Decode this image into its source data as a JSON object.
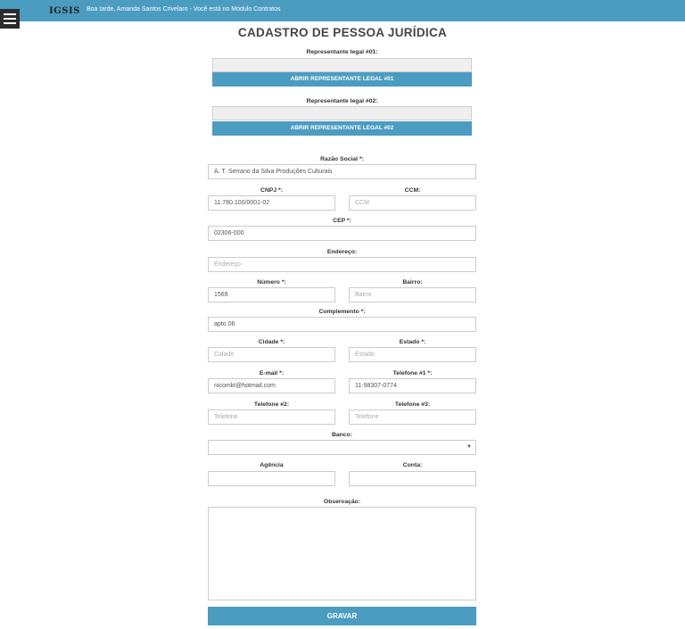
{
  "header": {
    "logo": "IGSIS",
    "greeting": "Boa tarde, Amanda Santos Crivelaro - Você está no Módulo Contratos"
  },
  "page": {
    "title": "CADASTRO DE PESSOA JURÍDICA"
  },
  "rep1": {
    "label": "Representante legal #01:",
    "button": "ABRIR REPRESENTANTE LEGAL #01"
  },
  "rep2": {
    "label": "Representante legal #02:",
    "button": "ABRIR REPRESENTANTE LEGAL #02"
  },
  "form": {
    "razao_social": {
      "label": "Razão Social *:",
      "value": "A. T. Serrano da Silva Produções Culturais"
    },
    "cnpj": {
      "label": "CNPJ *:",
      "value": "11.780.100/0001-02"
    },
    "ccm": {
      "label": "CCM:",
      "placeholder": "CCM"
    },
    "cep": {
      "label": "CEP *:",
      "value": "02306-000"
    },
    "endereco": {
      "label": "Endereço:",
      "placeholder": "Endereço"
    },
    "numero": {
      "label": "Número *:",
      "value": "1569"
    },
    "bairro": {
      "label": "Bairro:",
      "placeholder": "Bairro"
    },
    "complemento": {
      "label": "Complemento *:",
      "value": "apto 06"
    },
    "cidade": {
      "label": "Cidade *:",
      "placeholder": "Cidade"
    },
    "estado": {
      "label": "Estado *:",
      "placeholder": "Estado"
    },
    "email": {
      "label": "E-mail *:",
      "value": "nicomkt@hotmail.com"
    },
    "telefone1": {
      "label": "Telefone #1 *:",
      "value": "11-98307-0774"
    },
    "telefone2": {
      "label": "Telefone #2:",
      "placeholder": "Telefone"
    },
    "telefone3": {
      "label": "Telefone #3:",
      "placeholder": "Telefone"
    },
    "banco": {
      "label": "Banco:",
      "value": ""
    },
    "agencia": {
      "label": "Agência",
      "value": ""
    },
    "conta": {
      "label": "Conta:",
      "value": ""
    },
    "observacao": {
      "label": "Observação:"
    },
    "save_label": "GRAVAR"
  },
  "colors": {
    "accent": "#4b9cc1"
  }
}
